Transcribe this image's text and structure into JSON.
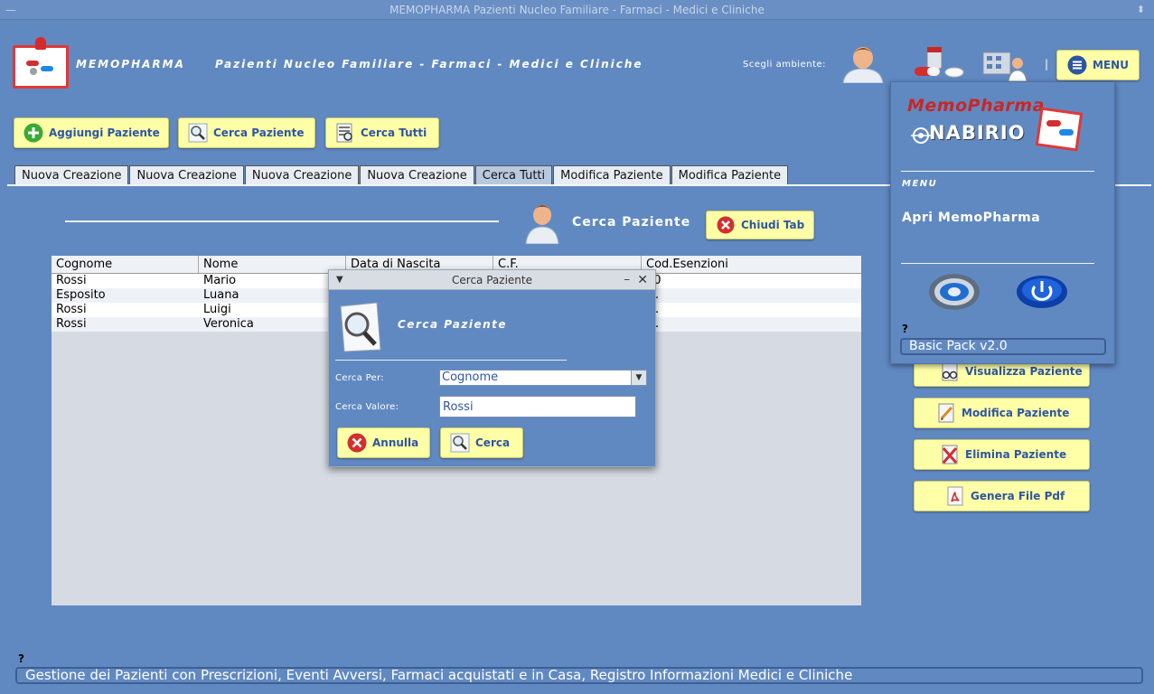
{
  "window": {
    "title": "MEMOPHARMA    Pazienti Nucleo Familiare - Farmaci - Medici e Cliniche"
  },
  "header": {
    "brand": "MEMOPHARMA",
    "app_title": "Pazienti Nucleo Familiare - Farmaci - Medici e Cliniche",
    "choose_env_label": "Scegli ambiente:",
    "menu_button": "MENU"
  },
  "toolbar": {
    "add_patient": "Aggiungi Paziente",
    "search_patient": "Cerca Paziente",
    "search_all": "Cerca Tutti"
  },
  "tabs": [
    {
      "label": "Nuova Creazione",
      "active": false
    },
    {
      "label": "Nuova Creazione",
      "active": false
    },
    {
      "label": "Nuova Creazione",
      "active": false
    },
    {
      "label": "Nuova Creazione",
      "active": false
    },
    {
      "label": "Cerca Tutti",
      "active": true
    },
    {
      "label": "Modifica Paziente",
      "active": false
    },
    {
      "label": "Modifica Paziente",
      "active": false
    }
  ],
  "section": {
    "title": "Cerca Paziente",
    "close_tab": "Chiudi Tab"
  },
  "table": {
    "columns": [
      "Cognome",
      "Nome",
      "Data di Nascita",
      "C.F.",
      "Cod.Esenzioni"
    ],
    "rows": [
      [
        "Rossi",
        "Mario",
        "",
        "",
        "00"
      ],
      [
        "Esposito",
        "Luana",
        "",
        "",
        "D."
      ],
      [
        "Rossi",
        "Luigi",
        "",
        "",
        "D."
      ],
      [
        "Rossi",
        "Veronica",
        "",
        "",
        "D."
      ]
    ]
  },
  "side_actions": {
    "view": "Visualizza Paziente",
    "edit": "Modifica Paziente",
    "delete": "Elimina Paziente",
    "pdf": "Genera File Pdf"
  },
  "menu_panel": {
    "logo_title": "MemoPharma",
    "logo_sub": "NABIRIO",
    "menu_label": "MENU",
    "open_item": "Apri MemoPharma",
    "help": "?",
    "version": "Basic Pack v2.0"
  },
  "dialog": {
    "title": "Cerca Paziente",
    "heading": "Cerca Paziente",
    "search_by_label": "Cerca Per:",
    "search_by_value": "Cognome",
    "search_value_label": "Cerca Valore:",
    "search_value": "Rossi",
    "cancel": "Annulla",
    "search": "Cerca"
  },
  "footer": {
    "help": "?",
    "status": "Gestione dei Pazienti con Prescrizioni, Eventi Avversi, Farmaci acquistati e in Casa, Registro Informazioni Medici e Cliniche"
  },
  "colors": {
    "background": "#6189c1",
    "button_bg": "#ffffa8",
    "button_text": "#2e56a0",
    "brand_red": "#c62828"
  }
}
